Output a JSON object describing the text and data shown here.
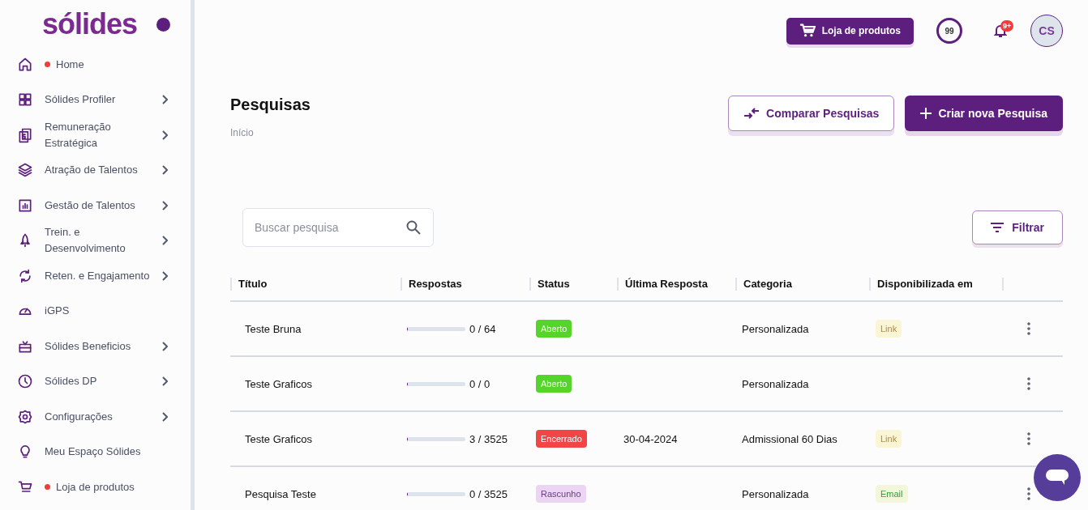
{
  "sidebar": {
    "logo": "sólides",
    "items": [
      {
        "label": "Home",
        "has_submenu": false,
        "notification": true
      },
      {
        "label": "Sólides Profiler",
        "has_submenu": true,
        "notification": false
      },
      {
        "label": "Remuneração Estratégica",
        "has_submenu": true,
        "notification": false
      },
      {
        "label": "Atração de Talentos",
        "has_submenu": true,
        "notification": false
      },
      {
        "label": "Gestão de Talentos",
        "has_submenu": true,
        "notification": false
      },
      {
        "label": "Trein. e Desenvolvimento",
        "has_submenu": true,
        "notification": false
      },
      {
        "label": "Reten. e Engajamento",
        "has_submenu": true,
        "notification": false
      },
      {
        "label": "iGPS",
        "has_submenu": false,
        "notification": false
      },
      {
        "label": "Sólides Beneficios",
        "has_submenu": true,
        "notification": false
      },
      {
        "label": "Sólides DP",
        "has_submenu": true,
        "notification": false
      },
      {
        "label": "Configurações",
        "has_submenu": true,
        "notification": false
      },
      {
        "label": "Meu Espaço Sólides",
        "has_submenu": false,
        "notification": false
      },
      {
        "label": "Loja de produtos",
        "has_submenu": false,
        "notification": true
      }
    ]
  },
  "topbar": {
    "store_button": "Loja de produtos",
    "points": "99",
    "notifications_badge": "9+",
    "avatar": "CS"
  },
  "page": {
    "title": "Pesquisas",
    "breadcrumb": "Início",
    "compare_button": "Comparar Pesquisas",
    "create_button": "Criar nova Pesquisa"
  },
  "search": {
    "placeholder": "Buscar pesquisa"
  },
  "filter_button": "Filtrar",
  "table": {
    "columns": [
      "Título",
      "Respostas",
      "Status",
      "Última Resposta",
      "Categoria",
      "Disponibilizada em"
    ],
    "rows": [
      {
        "title": "Teste Bruna",
        "level": 0,
        "responses": "0 / 64",
        "status": {
          "label": "Aberto",
          "color": "#55d42a"
        },
        "category": "Personalizada",
        "channel": {
          "label": "Link",
          "color": "#faf5d4"
        }
      },
      {
        "title": "Teste Graficos",
        "level": 0,
        "responses": "0 / 0",
        "status": {
          "label": "Aberto",
          "color": "#55d42a"
        },
        "category": "Personalizada"
      },
      {
        "title": "Teste Graficos",
        "level": 0.001,
        "responses": "3 / 3525",
        "status": {
          "label": "Encerrado",
          "color": "#f04646"
        },
        "last_response": "30-04-2024",
        "category": "Admissional 60 Dias",
        "channel": {
          "label": "Link",
          "color": "#faf5d4"
        }
      },
      {
        "title": "Pesquisa Teste",
        "level": 0,
        "responses": "0 / 3525",
        "status": {
          "label": "Rascunho",
          "color": "#ebd5f2"
        },
        "category": "Personalizada",
        "channel": {
          "label": "Email",
          "color": "#f2f7dc"
        }
      }
    ]
  }
}
